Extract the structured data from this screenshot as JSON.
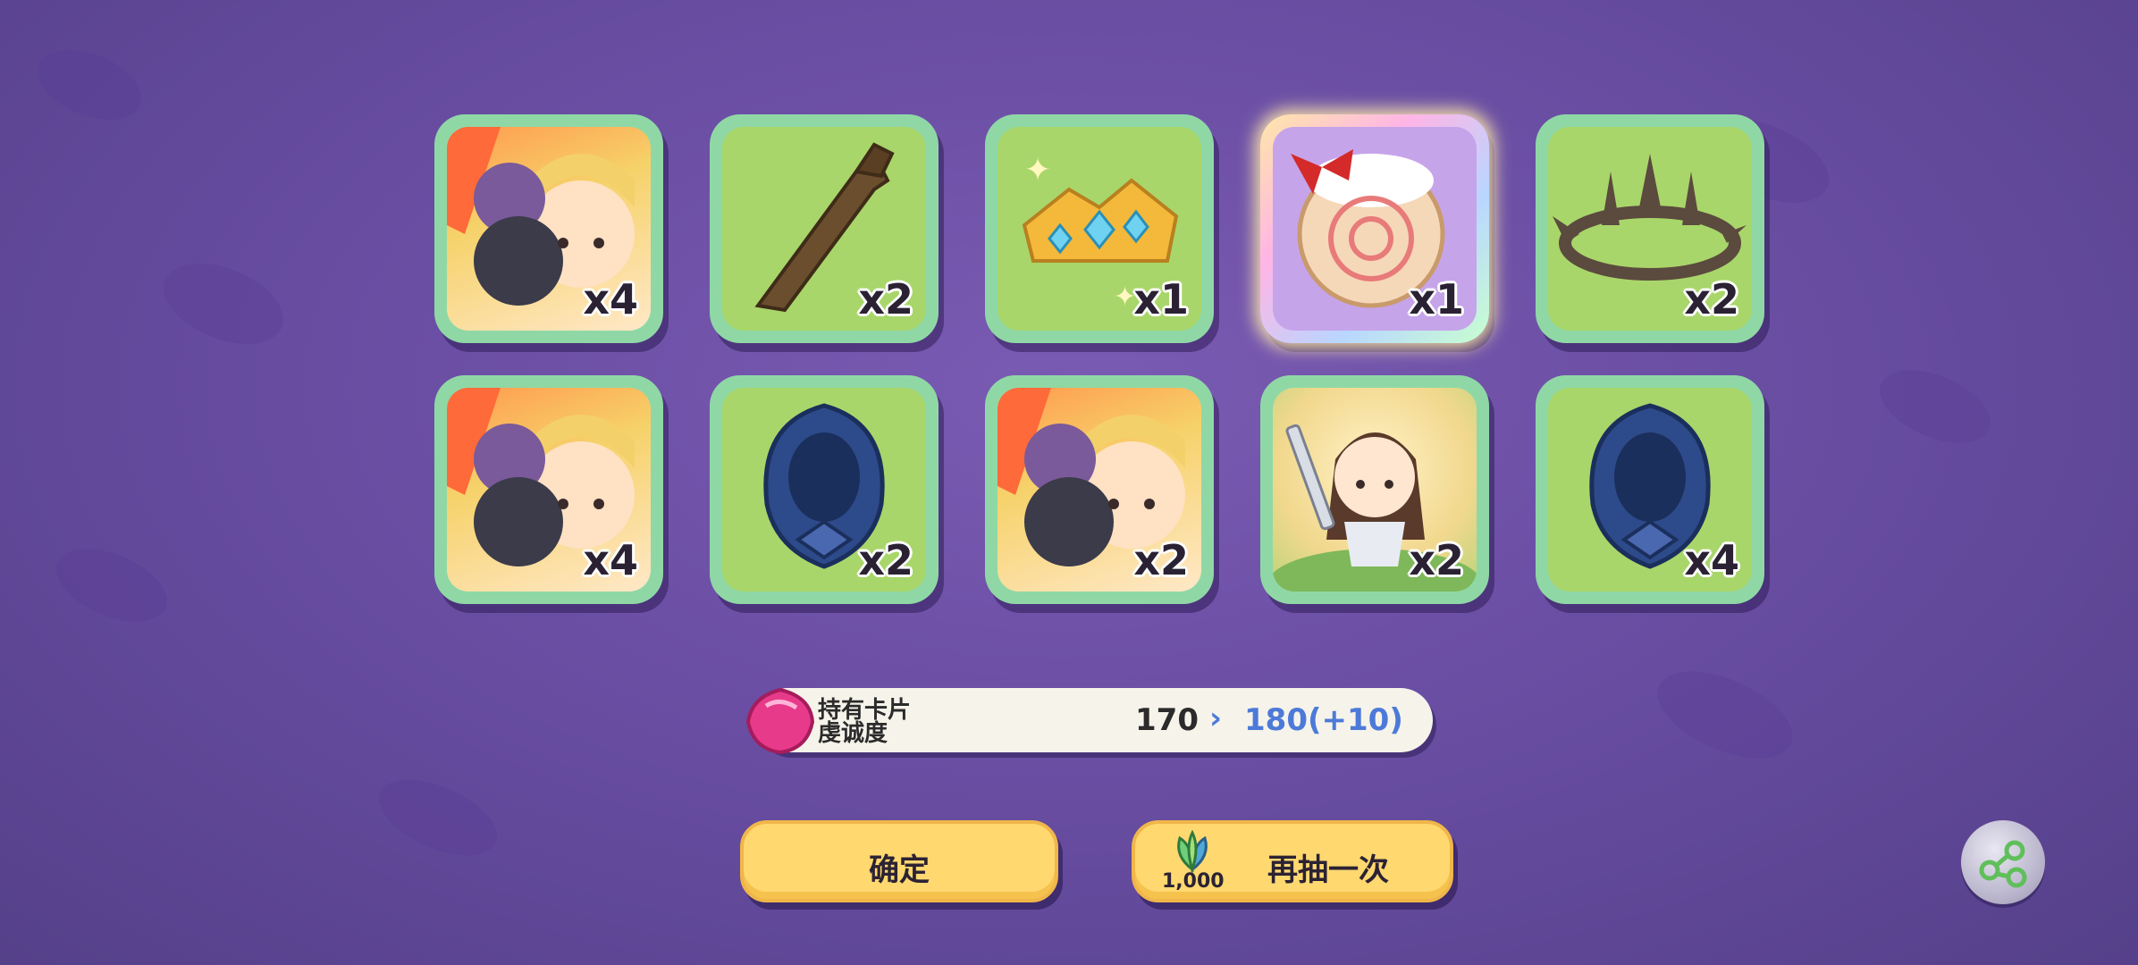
{
  "rewards": [
    {
      "item": "illustration-card",
      "count": "x4"
    },
    {
      "item": "wooden-dagger",
      "count": "x2"
    },
    {
      "item": "jeweled-tiara",
      "count": "x1"
    },
    {
      "item": "strawberry-roll-cake",
      "count": "x1",
      "rare": true
    },
    {
      "item": "thorn-crown",
      "count": "x2"
    },
    {
      "item": "illustration-card",
      "count": "x4"
    },
    {
      "item": "blue-hood",
      "count": "x2"
    },
    {
      "item": "illustration-card",
      "count": "x2"
    },
    {
      "item": "sword-girl-card",
      "count": "x2"
    },
    {
      "item": "blue-hood",
      "count": "x4"
    }
  ],
  "devotion": {
    "label_line1": "持有卡片",
    "label_line2": "虔诚度",
    "old_value": "170",
    "arrow": "›",
    "new_value": "180(+10)"
  },
  "buttons": {
    "confirm": "确定",
    "draw_again": "再抽一次",
    "draw_cost": "1,000"
  },
  "colors": {
    "background": "#6a4ea3",
    "card_frame": "#8fd8a6",
    "card_inner": "#a9d66a",
    "button": "#ffd870",
    "highlight_value": "#4d7ad9"
  }
}
